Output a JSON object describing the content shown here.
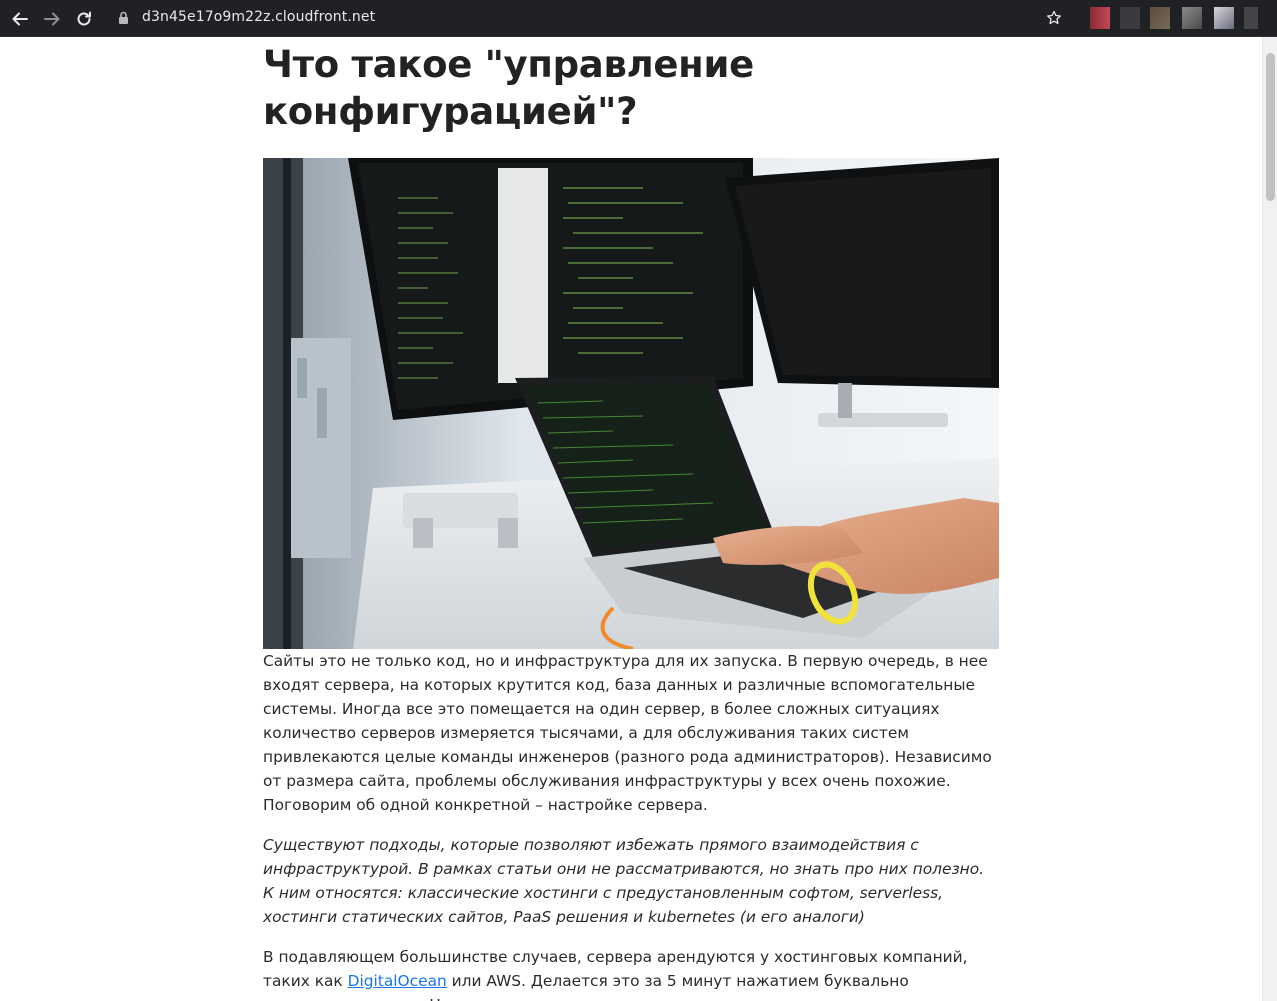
{
  "browser": {
    "url": "d3n45e17o9m22z.cloudfront.net",
    "back_icon": "arrow-left-icon",
    "forward_icon": "arrow-right-icon",
    "reload_icon": "reload-icon",
    "lock_icon": "lock-icon",
    "bookmark_icon": "star-icon"
  },
  "article": {
    "title": "Что такое \"управление конфигурацией\"?",
    "image_alt": "",
    "paragraph1": "Сайты это не только код, но и инфраструктура для их запуска. В первую очередь, в нее входят сервера, на которых крутится код, база данных и различные вспомогательные системы. Иногда все это помещается на один сервер, в более сложных ситуациях количество серверов измеряется тысячами, а для обслуживания таких систем привлекаются целые команды инженеров (разного рода администраторов). Независимо от размера сайта, проблемы обслуживания инфраструктуры у всех очень похожие. Поговорим об одной конкретной – настройке сервера.",
    "paragraph2": "Существуют подходы, которые позволяют избежать прямого взаимодействия с инфраструктурой. В рамках статьи они не рассматриваются, но знать про них полезно. К ним относятся: классические хостинги с предустановленным софтом, serverless, хостинги статических сайтов, PaaS решения и kubernetes (и его аналоги)",
    "paragraph3_before": "В подавляющем большинстве случаев, сервера арендуются у хостинговых компаний, таких как ",
    "paragraph3_link": "DigitalOcean",
    "paragraph3_after": " или AWS. Делается это за 5 минут нажатием буквально нескольких кнопок. Нас"
  }
}
